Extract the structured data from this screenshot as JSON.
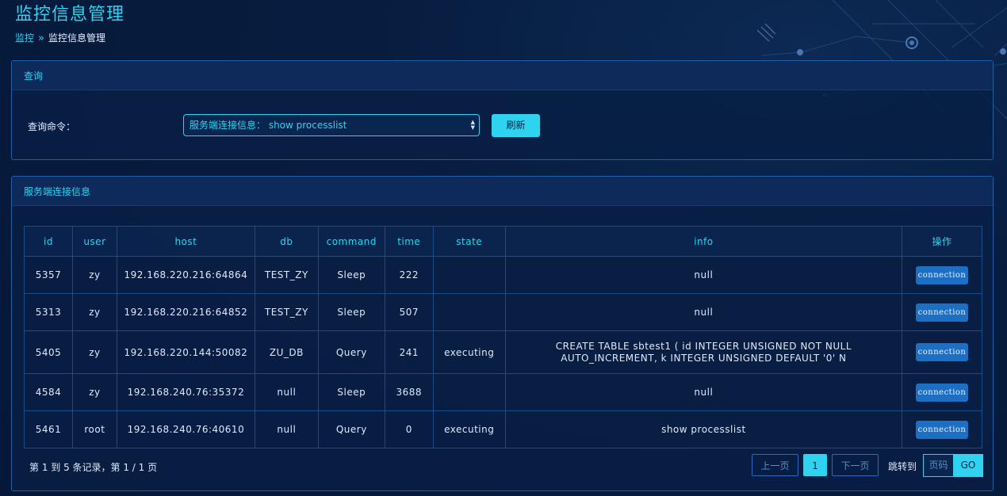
{
  "page_title": "监控信息管理",
  "breadcrumb": {
    "parent": "监控",
    "separator": "»",
    "current": "监控信息管理"
  },
  "query_panel": {
    "title": "查询",
    "command_label": "查询命令：",
    "selected_command": "服务端连接信息： show processlist",
    "refresh_label": "刷新"
  },
  "table_panel": {
    "title": "服务端连接信息",
    "columns": [
      "id",
      "user",
      "host",
      "db",
      "command",
      "time",
      "state",
      "info",
      "操作"
    ],
    "rows": [
      {
        "id": "5357",
        "user": "zy",
        "host": "192.168.220.216:64864",
        "db": "TEST_ZY",
        "command": "Sleep",
        "time": "222",
        "state": "",
        "info_line1": "null",
        "info_line2": "",
        "action": "connection"
      },
      {
        "id": "5313",
        "user": "zy",
        "host": "192.168.220.216:64852",
        "db": "TEST_ZY",
        "command": "Sleep",
        "time": "507",
        "state": "",
        "info_line1": "null",
        "info_line2": "",
        "action": "connection"
      },
      {
        "id": "5405",
        "user": "zy",
        "host": "192.168.220.144:50082",
        "db": "ZU_DB",
        "command": "Query",
        "time": "241",
        "state": "executing",
        "info_line1": "CREATE TABLE sbtest1 ( id INTEGER UNSIGNED NOT NULL",
        "info_line2": "AUTO_INCREMENT, k INTEGER UNSIGNED DEFAULT '0' N",
        "action": "connection"
      },
      {
        "id": "4584",
        "user": "zy",
        "host": "192.168.240.76:35372",
        "db": "null",
        "command": "Sleep",
        "time": "3688",
        "state": "",
        "info_line1": "null",
        "info_line2": "",
        "action": "connection"
      },
      {
        "id": "5461",
        "user": "root",
        "host": "192.168.240.76:40610",
        "db": "null",
        "command": "Query",
        "time": "0",
        "state": "executing",
        "info_line1": "show processlist",
        "info_line2": "",
        "action": "connection"
      }
    ],
    "footer_info": "第 1 到 5 条记录，第 1 / 1 页",
    "pagination": {
      "prev_label": "上一页",
      "current_page": "1",
      "next_label": "下一页",
      "jump_label": "跳转到",
      "page_placeholder": "页码",
      "go_label": "GO"
    }
  },
  "colors": {
    "accent": "#2fd3f0",
    "background": "#06183a",
    "button_blue": "#1d6fc4",
    "border": "#1f5fa8"
  }
}
